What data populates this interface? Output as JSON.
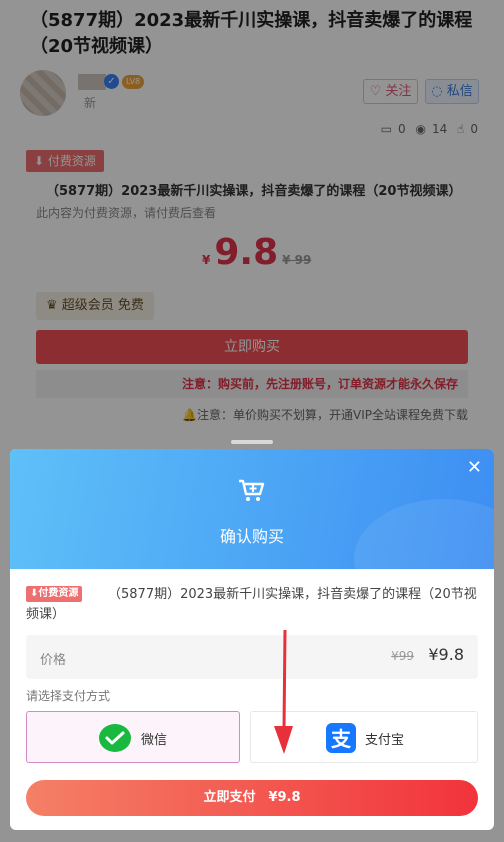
{
  "post": {
    "title": "（5877期）2023最新千川实操课，抖音卖爆了的课程（20节视频课）",
    "author_suffix": "新",
    "level_badge": "LV8",
    "follow_label": "关注",
    "message_label": "私信",
    "comments": "0",
    "views": "14",
    "likes": "0"
  },
  "resource": {
    "tag": "付费资源",
    "name": "（5877期）2023最新千川实操课，抖音卖爆了的课程（20节视频课）",
    "desc": "此内容为付费资源，请付费后查看",
    "currency": "¥",
    "price": "9.8",
    "old_price": "¥ 99",
    "vip_label": "超级会员 免费",
    "buy_label": "立即购买",
    "notice": "注意：购买前，先注册账号，订单资源才能永久保存",
    "notice2": "注意：单价购买不划算，开通VIP全站课程免费下载"
  },
  "modal": {
    "title": "确认购买",
    "tag": "付费资源",
    "item_name": "（5877期）2023最新千川实操课，抖音卖爆了的课程（20节视频课）",
    "price_label": "价格",
    "old_price": "¥99",
    "price": "¥9.8",
    "pay_method_label": "请选择支付方式",
    "wechat_label": "微信",
    "alipay_label": "支付宝",
    "pay_button": "立即支付　¥9.8"
  },
  "colors": {
    "accent": "#ef4f55",
    "header_blue": "#3d8ef2",
    "wechat": "#19b83f",
    "alipay": "#1677ff"
  }
}
